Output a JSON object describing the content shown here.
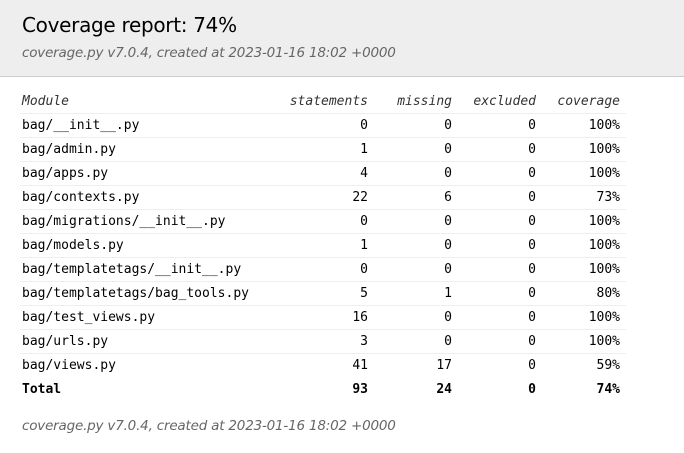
{
  "header": {
    "title": "Coverage report: 74%",
    "subtitle": {
      "tool": "coverage.py v7.0.4",
      "created": ", created at 2023-01-16 18:02 +0000"
    }
  },
  "table": {
    "columns": {
      "module": "Module",
      "statements": "statements",
      "missing": "missing",
      "excluded": "excluded",
      "coverage": "coverage"
    },
    "rows": [
      {
        "module": "bag/__init__.py",
        "statements": "0",
        "missing": "0",
        "excluded": "0",
        "coverage": "100%"
      },
      {
        "module": "bag/admin.py",
        "statements": "1",
        "missing": "0",
        "excluded": "0",
        "coverage": "100%"
      },
      {
        "module": "bag/apps.py",
        "statements": "4",
        "missing": "0",
        "excluded": "0",
        "coverage": "100%"
      },
      {
        "module": "bag/contexts.py",
        "statements": "22",
        "missing": "6",
        "excluded": "0",
        "coverage": "73%"
      },
      {
        "module": "bag/migrations/__init__.py",
        "statements": "0",
        "missing": "0",
        "excluded": "0",
        "coverage": "100%"
      },
      {
        "module": "bag/models.py",
        "statements": "1",
        "missing": "0",
        "excluded": "0",
        "coverage": "100%"
      },
      {
        "module": "bag/templatetags/__init__.py",
        "statements": "0",
        "missing": "0",
        "excluded": "0",
        "coverage": "100%"
      },
      {
        "module": "bag/templatetags/bag_tools.py",
        "statements": "5",
        "missing": "1",
        "excluded": "0",
        "coverage": "80%"
      },
      {
        "module": "bag/test_views.py",
        "statements": "16",
        "missing": "0",
        "excluded": "0",
        "coverage": "100%"
      },
      {
        "module": "bag/urls.py",
        "statements": "3",
        "missing": "0",
        "excluded": "0",
        "coverage": "100%"
      },
      {
        "module": "bag/views.py",
        "statements": "41",
        "missing": "17",
        "excluded": "0",
        "coverage": "59%"
      }
    ],
    "total": {
      "module": "Total",
      "statements": "93",
      "missing": "24",
      "excluded": "0",
      "coverage": "74%"
    }
  },
  "footer": {
    "tool": "coverage.py v7.0.4",
    "created": ", created at 2023-01-16 18:02 +0000"
  }
}
